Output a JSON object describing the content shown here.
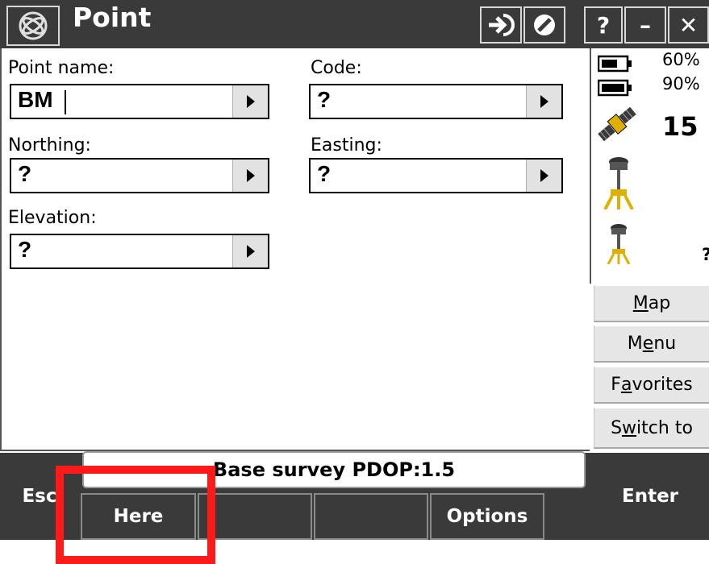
{
  "window": {
    "title": "Point",
    "buttons": {
      "help": "?",
      "minimize": "–",
      "close": "✕"
    }
  },
  "form": {
    "point_name": {
      "label": "Point name:",
      "value": "BM"
    },
    "code": {
      "label": "Code:",
      "value": "?"
    },
    "northing": {
      "label": "Northing:",
      "value": "?"
    },
    "easting": {
      "label": "Easting:",
      "value": "?"
    },
    "elevation": {
      "label": "Elevation:",
      "value": "?"
    }
  },
  "status_pane": {
    "battery1": "60%",
    "battery2": "90%",
    "satellites": "15",
    "rover_status": "?"
  },
  "side_buttons": [
    {
      "pre": "",
      "ul": "M",
      "post": "ap"
    },
    {
      "pre": "M",
      "ul": "e",
      "post": "nu"
    },
    {
      "pre": "F",
      "ul": "a",
      "post": "vorites"
    },
    {
      "pre": "S",
      "ul": "w",
      "post": "itch to"
    }
  ],
  "bottom": {
    "status_text": "Base survey  PDOP:1.5",
    "esc": "Esc",
    "enter": "Enter",
    "softkeys": [
      "Here",
      "",
      "",
      "Options"
    ]
  },
  "colors": {
    "titlebar": "#3a3a3a",
    "highlight": "#ff1a1a"
  }
}
